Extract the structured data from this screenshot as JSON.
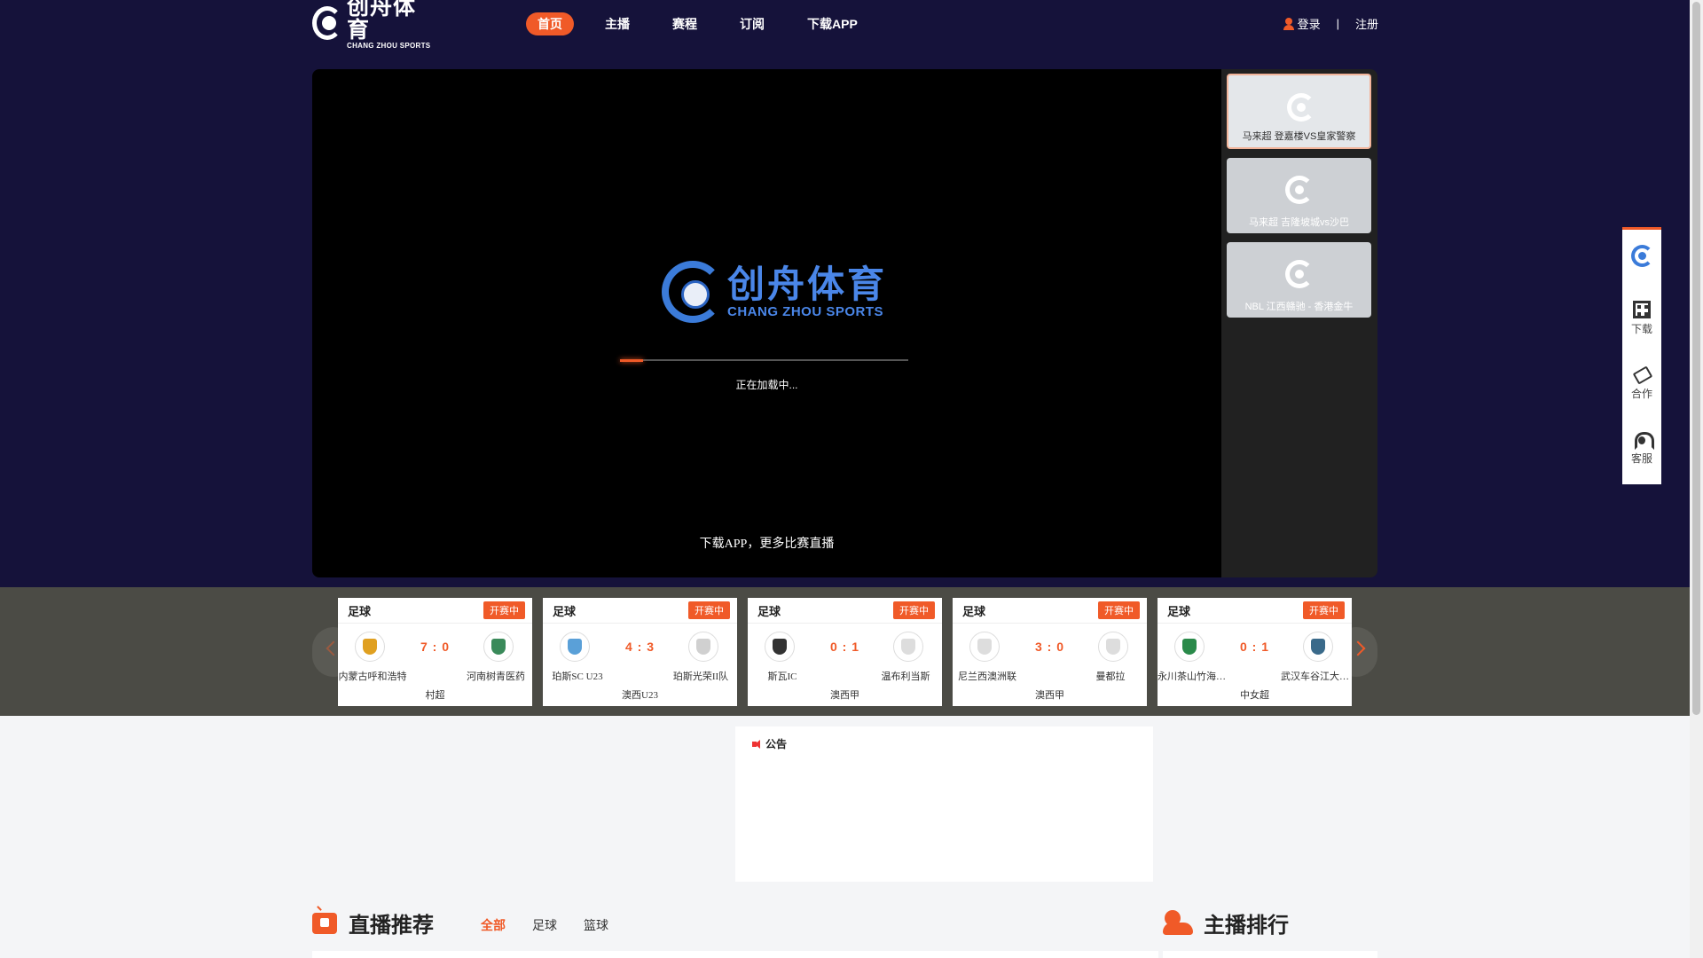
{
  "header": {
    "logo": {
      "cn": "创舟体育",
      "en": "CHANG ZHOU SPORTS"
    },
    "nav": [
      {
        "label": "首页",
        "active": true
      },
      {
        "label": "主播",
        "active": false
      },
      {
        "label": "赛程",
        "active": false
      },
      {
        "label": "订阅",
        "active": false
      },
      {
        "label": "下载APP",
        "active": false
      }
    ],
    "login": "登录",
    "separator": "|",
    "register": "注册"
  },
  "player": {
    "logo_cn": "创舟体育",
    "logo_en": "CHANG ZHOU SPORTS",
    "loading_text": "正在加载中...",
    "loading_progress": 0.08,
    "download_promo": "下载APP，更多比赛直播"
  },
  "side_streams": [
    {
      "label": "马来超 登嘉楼VS皇家警察",
      "active": true
    },
    {
      "label": "马来超 吉隆坡城vs沙巴",
      "active": false
    },
    {
      "label": "NBL 江西赣驰 - 香港金牛",
      "active": false
    }
  ],
  "matches": [
    {
      "sport": "足球",
      "status": "开赛中",
      "score": "7 : 0",
      "home": "内蒙古呼和浩特",
      "away": "河南树青医药",
      "league": "村超",
      "home_color": "#e0a020",
      "away_color": "#3a8a5a"
    },
    {
      "sport": "足球",
      "status": "开赛中",
      "score": "4 : 3",
      "home": "珀斯SC U23",
      "away": "珀斯光荣II队",
      "league": "澳西U23",
      "home_color": "#5aa0d8",
      "away_color": "#d0d0d0"
    },
    {
      "sport": "足球",
      "status": "开赛中",
      "score": "0 : 1",
      "home": "斯瓦IC",
      "away": "温布利当斯",
      "league": "澳西甲",
      "home_color": "#333333",
      "away_color": "#dddddd"
    },
    {
      "sport": "足球",
      "status": "开赛中",
      "score": "3 : 0",
      "home": "尼兰西澳洲联",
      "away": "曼都拉",
      "league": "澳西甲",
      "home_color": "#dddddd",
      "away_color": "#dddddd"
    },
    {
      "sport": "足球",
      "status": "开赛中",
      "score": "0 : 1",
      "home": "永川茶山竹海女足",
      "away": "武汉车谷江大女足",
      "league": "中女超",
      "home_color": "#2a8a4a",
      "away_color": "#3a6a8a"
    }
  ],
  "notice": {
    "title": "公告"
  },
  "live_section": {
    "title": "直播推荐",
    "tabs": [
      {
        "label": "全部",
        "active": true
      },
      {
        "label": "足球",
        "active": false
      },
      {
        "label": "篮球",
        "active": false
      }
    ]
  },
  "rank_section": {
    "title": "主播排行"
  },
  "float_bar": {
    "download": "下载",
    "cooperate": "合作",
    "service": "客服"
  }
}
